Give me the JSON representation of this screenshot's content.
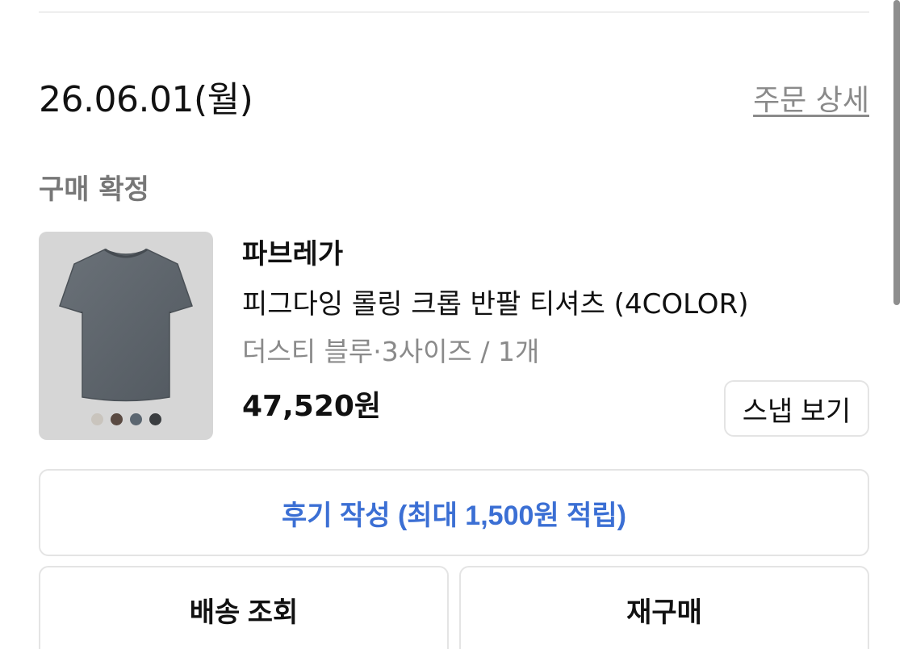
{
  "order": {
    "date": "26.06.01(월)",
    "detail_link": "주문 상세",
    "status": "구매 확정"
  },
  "product": {
    "brand": "파브레가",
    "name": "피그다잉 롤링 크롭 반팔 티셔츠 (4COLOR)",
    "option": "더스티 블루·3사이즈 / 1개",
    "price": "47,520원",
    "image_icon": "tshirt-photo",
    "shirt_color": "#5e656b",
    "swatch_colors": [
      "#c9c4bd",
      "#5a4a42",
      "#5b6670",
      "#3a3d40"
    ]
  },
  "actions": {
    "snap_label": "스냅 보기",
    "review_label": "후기 작성 (최대 1,500원 적립)",
    "shipping_label": "배송 조회",
    "rebuy_label": "재구매"
  },
  "colors": {
    "accent": "#3b6fd4",
    "muted_text": "#8a8a8a",
    "border": "#e4e4e4"
  }
}
